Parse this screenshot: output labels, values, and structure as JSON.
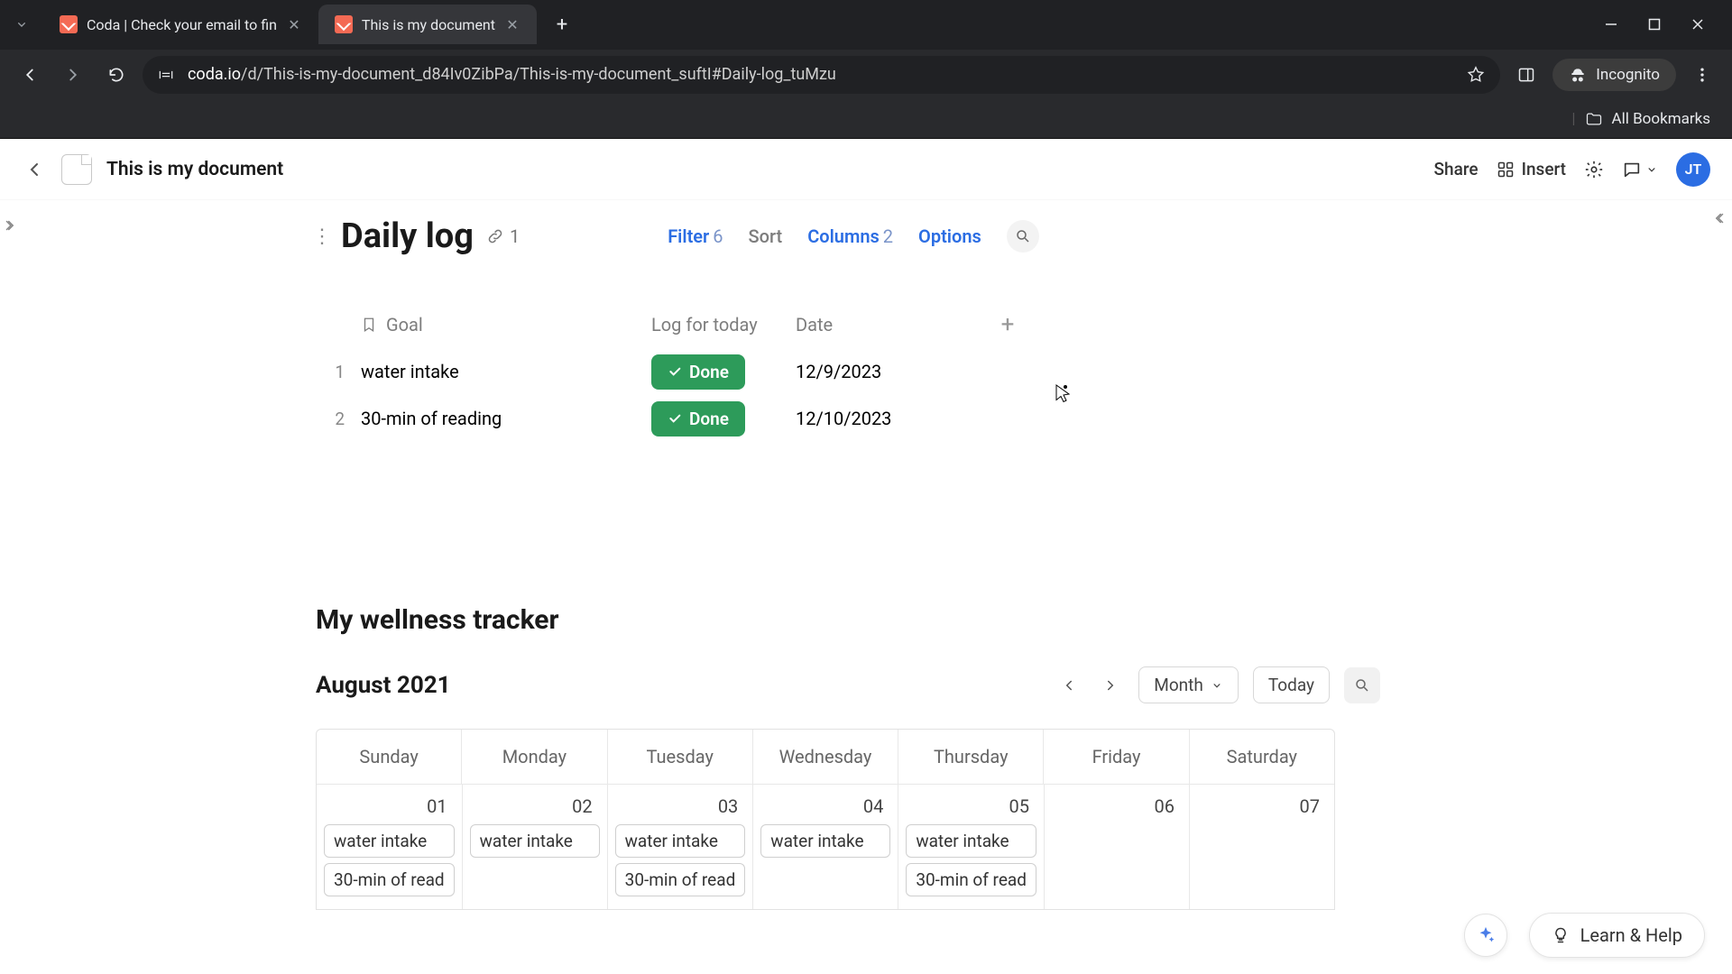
{
  "browser": {
    "tabs": [
      {
        "title": "Coda | Check your email to fin",
        "active": false
      },
      {
        "title": "This is my document",
        "active": true
      }
    ],
    "url_prefix": "coda.io",
    "url_path": "/d/This-is-my-document_d84Iv0ZibPa/This-is-my-document_suftI#Daily-log_tuMzu",
    "incognito_label": "Incognito",
    "all_bookmarks_label": "All Bookmarks"
  },
  "header": {
    "doc_title": "This is my document",
    "share_label": "Share",
    "insert_label": "Insert",
    "avatar_initials": "JT"
  },
  "daily_log": {
    "title": "Daily log",
    "link_count": "1",
    "toolbar": {
      "filter_label": "Filter",
      "filter_count": "6",
      "sort_label": "Sort",
      "columns_label": "Columns",
      "columns_count": "2",
      "options_label": "Options"
    },
    "columns": {
      "goal_label": "Goal",
      "log_label": "Log for today",
      "date_label": "Date"
    },
    "rows": [
      {
        "num": "1",
        "goal": "water intake",
        "log": "Done",
        "date": "12/9/2023"
      },
      {
        "num": "2",
        "goal": "30-min of reading",
        "log": "Done",
        "date": "12/10/2023"
      }
    ]
  },
  "tracker": {
    "title": "My wellness tracker",
    "month_label": "August 2021",
    "view_label": "Month",
    "today_label": "Today",
    "day_headers": [
      "Sunday",
      "Monday",
      "Tuesday",
      "Wednesday",
      "Thursday",
      "Friday",
      "Saturday"
    ],
    "week1": [
      {
        "date": "01",
        "events": [
          "water intake",
          "30-min of read"
        ]
      },
      {
        "date": "02",
        "events": [
          "water intake"
        ]
      },
      {
        "date": "03",
        "events": [
          "water intake",
          "30-min of read"
        ]
      },
      {
        "date": "04",
        "events": [
          "water intake"
        ]
      },
      {
        "date": "05",
        "events": [
          "water intake",
          "30-min of read"
        ]
      },
      {
        "date": "06",
        "events": []
      },
      {
        "date": "07",
        "events": []
      }
    ]
  },
  "footer": {
    "help_label": "Learn & Help"
  }
}
